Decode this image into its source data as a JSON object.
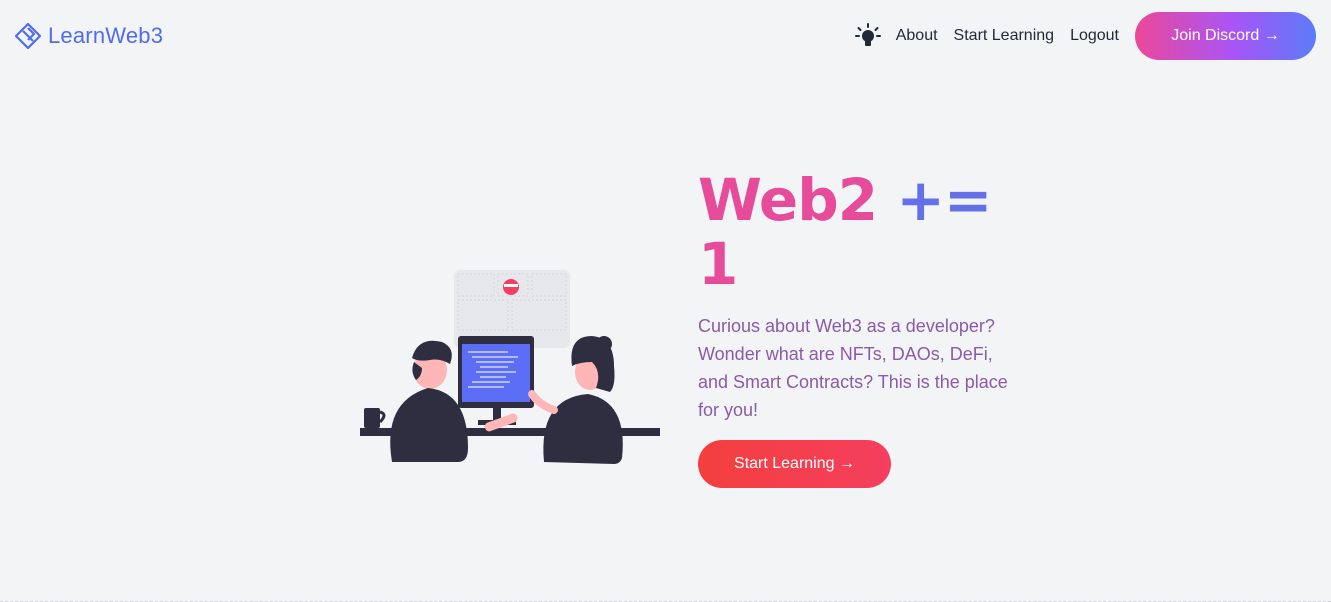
{
  "header": {
    "logo_text": "LearnWeb3",
    "nav": {
      "theme_icon": "lightbulb-icon",
      "about": "About",
      "start_learning": "Start Learning",
      "logout": "Logout"
    },
    "discord_button": "Join Discord →"
  },
  "hero": {
    "headline_part1": "Web2",
    "headline_part2": "+=",
    "headline_part3": "1",
    "subtext": "Curious about Web3 as a developer? Wonder what are NFTs, DAOs, DeFi, and Smart Contracts? This is the place for you!",
    "cta": "Start Learning →"
  },
  "colors": {
    "brand": "#4f6cf0",
    "pink": "#e64c9a",
    "purple": "#8b5ba7",
    "cta_red": "#f43f3f",
    "background": "#f3f4f6"
  }
}
